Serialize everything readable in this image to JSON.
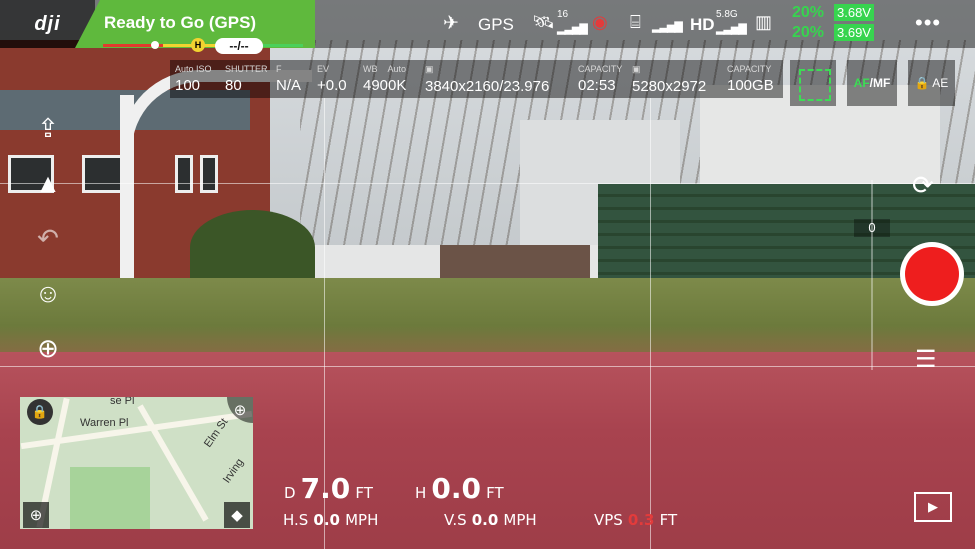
{
  "top": {
    "logo": "dji",
    "status": "Ready to Go (GPS)",
    "home_badge": "H",
    "flight_time": "--/--",
    "gps_label": "GPS",
    "sat_count": "16",
    "hd_label": "HD",
    "band": "5.8G",
    "battery_1_pct": "20%",
    "battery_1_v": "3.68V",
    "battery_2_pct": "20%",
    "battery_2_v": "3.69V",
    "more": "•••"
  },
  "params": [
    {
      "label": "Auto ISO",
      "value": "100"
    },
    {
      "label": "SHUTTER",
      "value": "80"
    },
    {
      "label": "F",
      "value": "N/A"
    },
    {
      "label": "EV",
      "value": "+0.0"
    },
    {
      "label": "WB",
      "value": "4900K",
      "sub": "Auto"
    },
    {
      "label": "",
      "value": "3840x2160/23.976"
    },
    {
      "label": "CAPACITY",
      "value": "02:53"
    },
    {
      "label": "",
      "value": "5280x2972"
    },
    {
      "label": "CAPACITY",
      "value": "100GB"
    }
  ],
  "camera_controls": {
    "af_label": "AF",
    "mf_label": "MF",
    "ae_label": "AE",
    "gimbal_value": "0"
  },
  "map": {
    "street_1": "Warren Pl",
    "street_2": "Elm St",
    "street_3": "Irving",
    "street_4": "se Pl"
  },
  "telemetry": {
    "d_label": "D",
    "d_value": "7.0",
    "d_unit": "FT",
    "h_label": "H",
    "h_value": "0.0",
    "h_unit": "FT",
    "hs_label": "H.S",
    "hs_value": "0.0",
    "hs_unit": "MPH",
    "vs_label": "V.S",
    "vs_value": "0.0",
    "vs_unit": "MPH",
    "vps_label": "VPS",
    "vps_value": "0.3",
    "vps_unit": "FT"
  },
  "colors": {
    "status_green": "#5fb93d",
    "record_red": "#ee1e1e",
    "battery_green": "#37d44f",
    "focus_green": "#3ddc55"
  },
  "icons": [
    "takeoff-icon",
    "navigation-icon",
    "return-home-icon",
    "remote-controller-icon",
    "target-icon",
    "camera-switch-icon",
    "settings-icon",
    "playback-icon",
    "map-locate-icon",
    "map-zoom-icon",
    "map-eraser-icon"
  ]
}
